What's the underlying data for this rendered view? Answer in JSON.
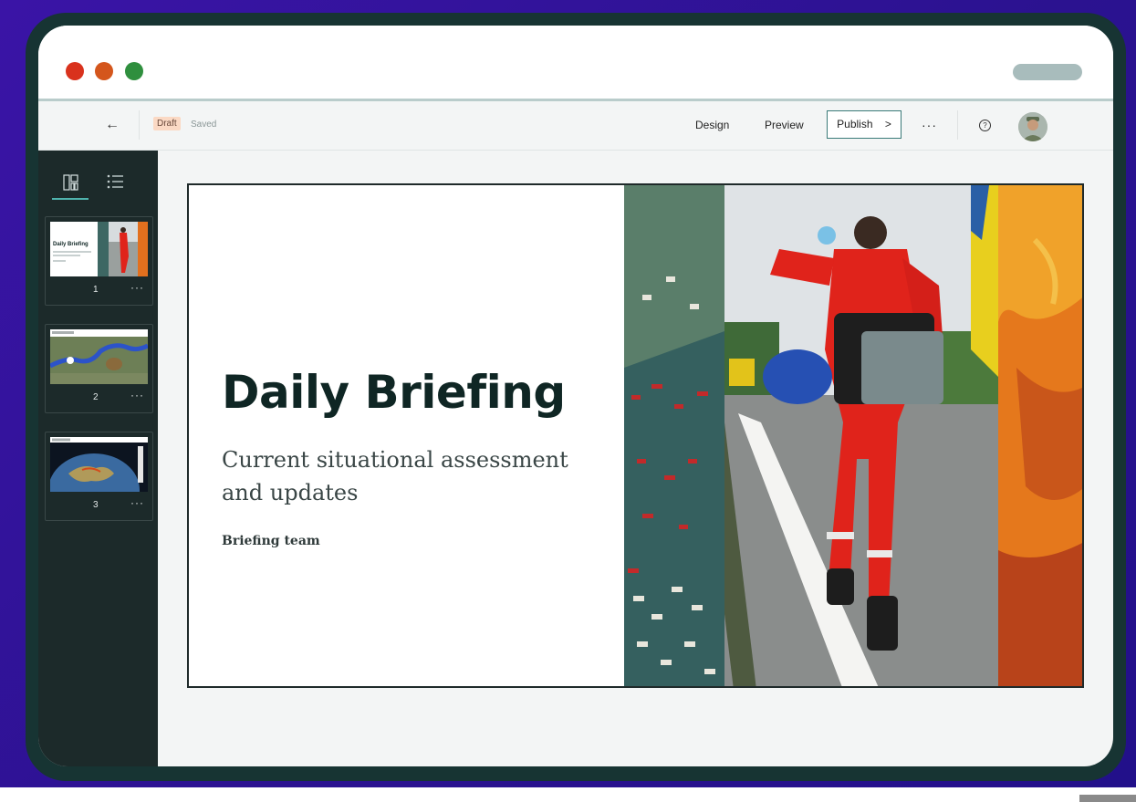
{
  "toolbar": {
    "status_badge": "Draft",
    "save_state": "Saved",
    "design_label": "Design",
    "preview_label": "Preview",
    "publish_label": "Publish",
    "publish_chevron": ">",
    "more_label": "···",
    "help_label": "?",
    "back_label": "←"
  },
  "sidebar": {
    "slides": [
      {
        "number": "1",
        "thumb_title": "Daily Briefing",
        "more": "···"
      },
      {
        "number": "2",
        "more": "···"
      },
      {
        "number": "3",
        "more": "···"
      }
    ]
  },
  "slide": {
    "title": "Daily Briefing",
    "subtitle": "Current situational assessment and updates",
    "author": "Briefing team"
  },
  "colors": {
    "background": "#2b1290",
    "device_frame": "#173433",
    "sidebar": "#1c2a2a",
    "accent": "#4fb3ad",
    "draft_badge": "#fbd9c4",
    "title_text": "#0f2624"
  }
}
